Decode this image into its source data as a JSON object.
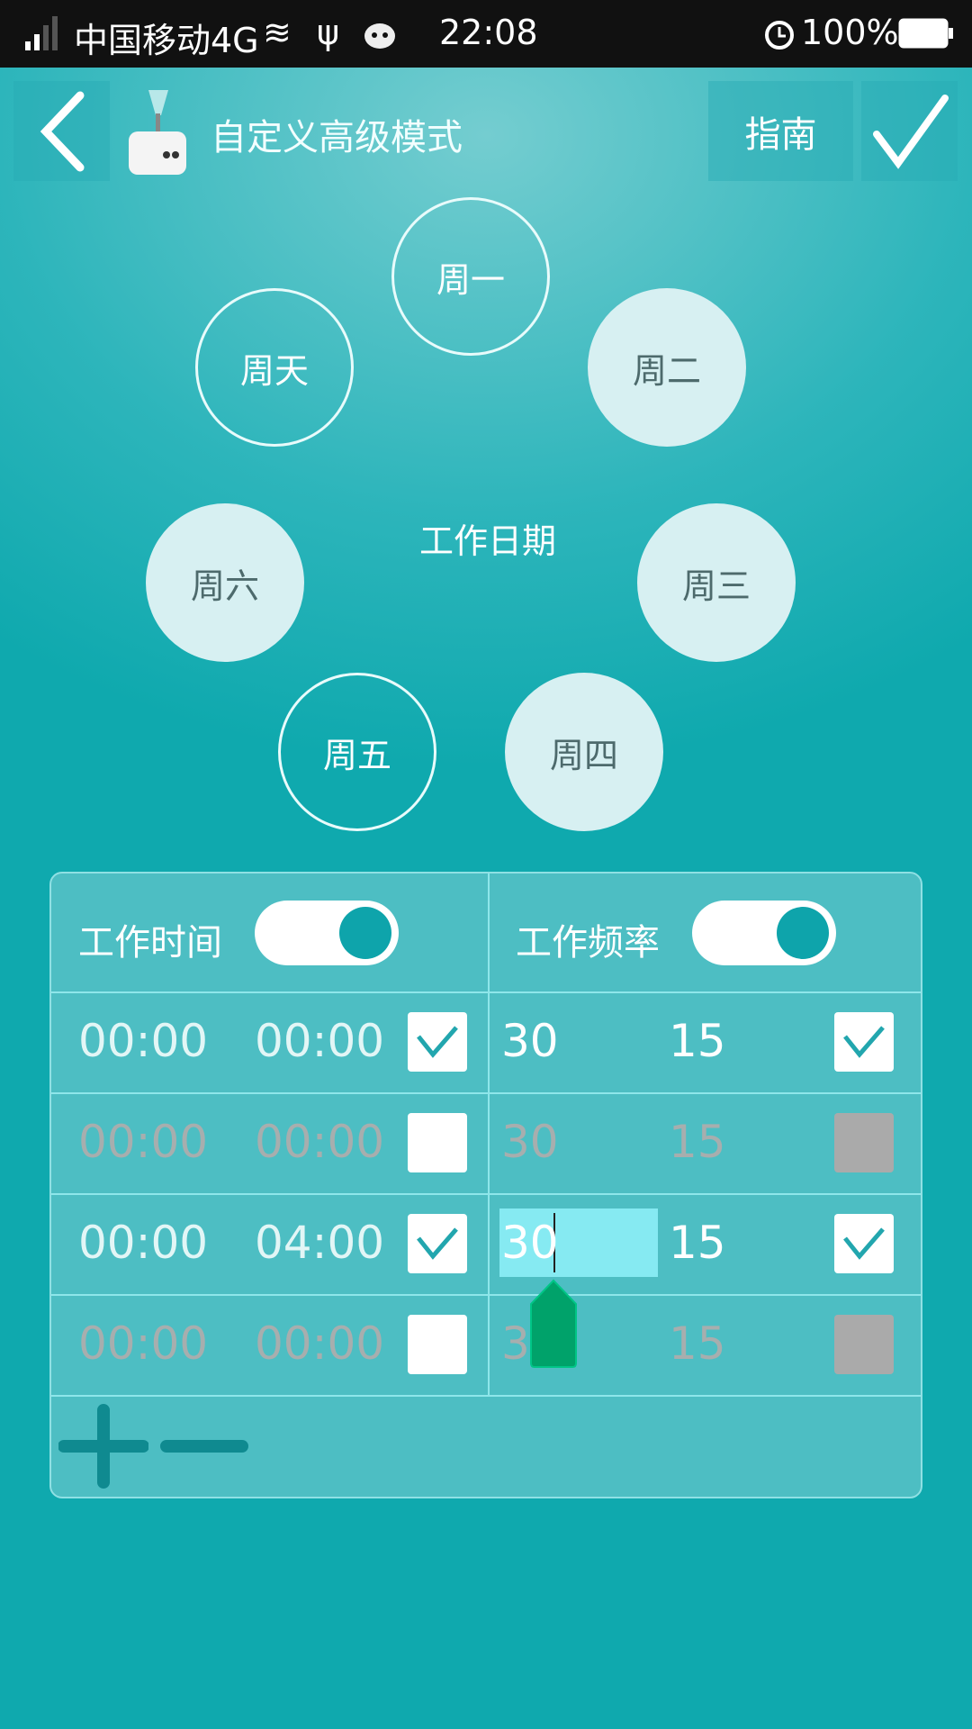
{
  "status_bar": {
    "carrier": "中国移动4G",
    "time": "22:08",
    "battery": "100%",
    "icons": [
      "signal-icon",
      "wifi-icon",
      "usb-icon",
      "android-icon",
      "alarm-icon",
      "battery-icon"
    ]
  },
  "header": {
    "title": "自定义高级模式",
    "guide_label": "指南",
    "icons": [
      "back-icon",
      "device-logo",
      "confirm-check-icon"
    ]
  },
  "work_days": {
    "label": "工作日期",
    "days": [
      {
        "label": "周一",
        "selected": false
      },
      {
        "label": "周二",
        "selected": true
      },
      {
        "label": "周三",
        "selected": true
      },
      {
        "label": "周四",
        "selected": true
      },
      {
        "label": "周五",
        "selected": false
      },
      {
        "label": "周六",
        "selected": true
      },
      {
        "label": "周天",
        "selected": false
      }
    ]
  },
  "table": {
    "time_header": "工作时间",
    "time_toggle_on": true,
    "freq_header": "工作频率",
    "freq_toggle_on": true,
    "rows": [
      {
        "start": "00:00",
        "end": "00:00",
        "time_checked": true,
        "freq_a": "30",
        "freq_b": "15",
        "freq_checked": true
      },
      {
        "start": "00:00",
        "end": "00:00",
        "time_checked": false,
        "freq_a": "30",
        "freq_b": "15",
        "freq_checked": false
      },
      {
        "start": "00:00",
        "end": "04:00",
        "time_checked": true,
        "freq_a": "30",
        "freq_b": "15",
        "freq_checked": true
      },
      {
        "start": "00:00",
        "end": "00:00",
        "time_checked": false,
        "freq_a": "30",
        "freq_b": "15",
        "freq_checked": false
      }
    ],
    "footer_icons": [
      "add-icon",
      "remove-icon"
    ]
  },
  "colors": {
    "accent": "#0ea4ab",
    "panel": "#4dbec3",
    "selected_day": "#d7f0f2",
    "text_selection": "#86eaf2",
    "cursor_handle": "#00a26a"
  }
}
